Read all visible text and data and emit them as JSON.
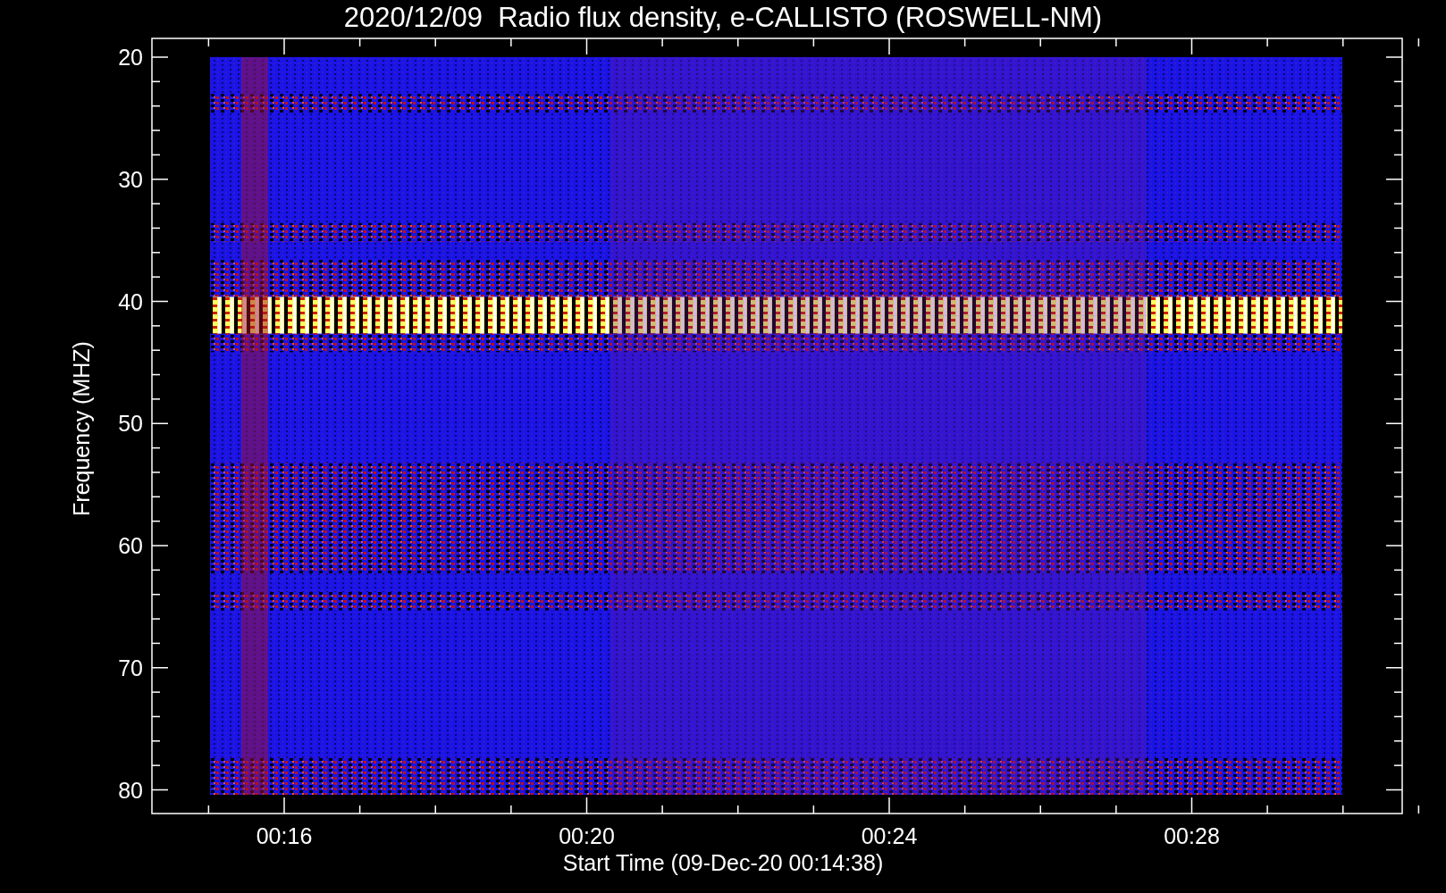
{
  "plot": {
    "title": "2020/12/09  Radio flux density, e-CALLISTO (ROSWELL-NM)",
    "ylabel": "Frequency (MHZ)",
    "xlabel": "Start Time (09-Dec-20 00:14:38)",
    "yticks": [
      "20",
      "30",
      "40",
      "50",
      "60",
      "70",
      "80"
    ],
    "xticks": [
      "00:16",
      "00:20",
      "00:24",
      "00:28"
    ]
  }
}
